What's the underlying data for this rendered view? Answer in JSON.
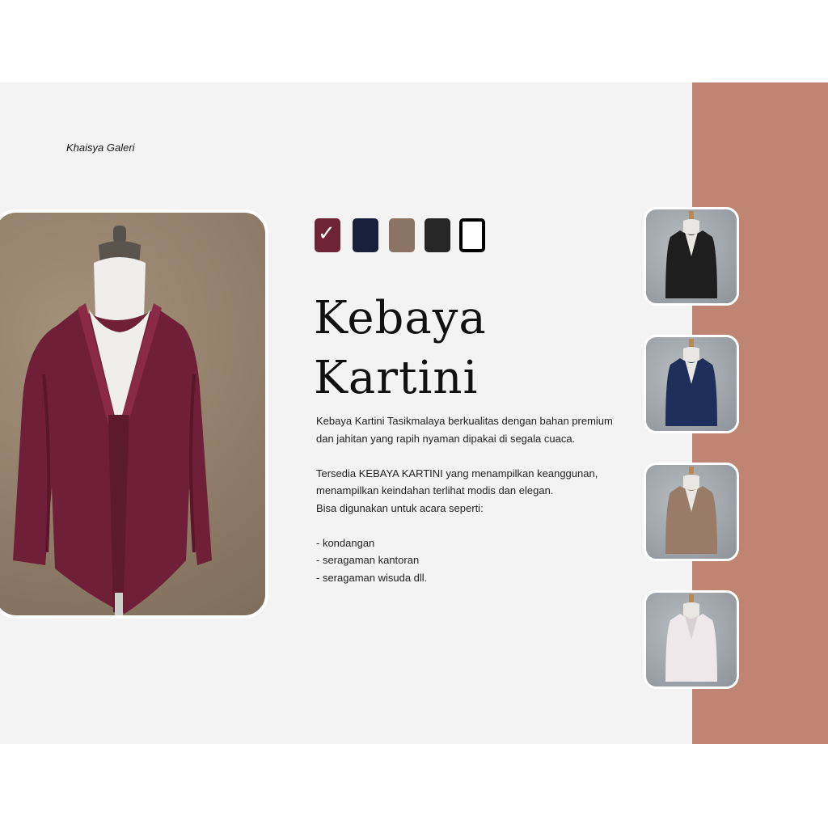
{
  "brand": {
    "name": "Khaisya Galeri"
  },
  "colors": {
    "panel": "#f3f3f3",
    "accent": "#bf8472",
    "selected_variant": "maroon"
  },
  "swatches": [
    {
      "name": "maroon",
      "color": "#6e2436",
      "selected": true,
      "check_icon": "✓"
    },
    {
      "name": "navy",
      "color": "#17213a",
      "selected": false
    },
    {
      "name": "mocca",
      "color": "#8c7465",
      "selected": false
    },
    {
      "name": "black",
      "color": "#262626",
      "selected": false
    },
    {
      "name": "white",
      "color": "#ffffff",
      "selected": false
    }
  ],
  "product": {
    "title_line1": "Kebaya",
    "title_line2": "Kartini",
    "desc_p1": "Kebaya Kartini Tasikmalaya berkualitas dengan bahan premium dan jahitan yang rapih nyaman dipakai di segala cuaca.",
    "desc_p2": "Tersedia KEBAYA KARTINI yang menampilkan keanggunan, menampilkan keindahan terlihat modis dan elegan.",
    "desc_p3": "Bisa digunakan untuk acara seperti:",
    "uses": [
      "- kondangan",
      "- seragaman kantoran",
      "- seragaman wisuda dll."
    ]
  },
  "thumbnails": [
    {
      "name": "black",
      "color": "#1e1e1e"
    },
    {
      "name": "navy",
      "color": "#1d2f5a"
    },
    {
      "name": "mocca",
      "color": "#9a7b67"
    },
    {
      "name": "white",
      "color": "#eee8ea"
    }
  ]
}
